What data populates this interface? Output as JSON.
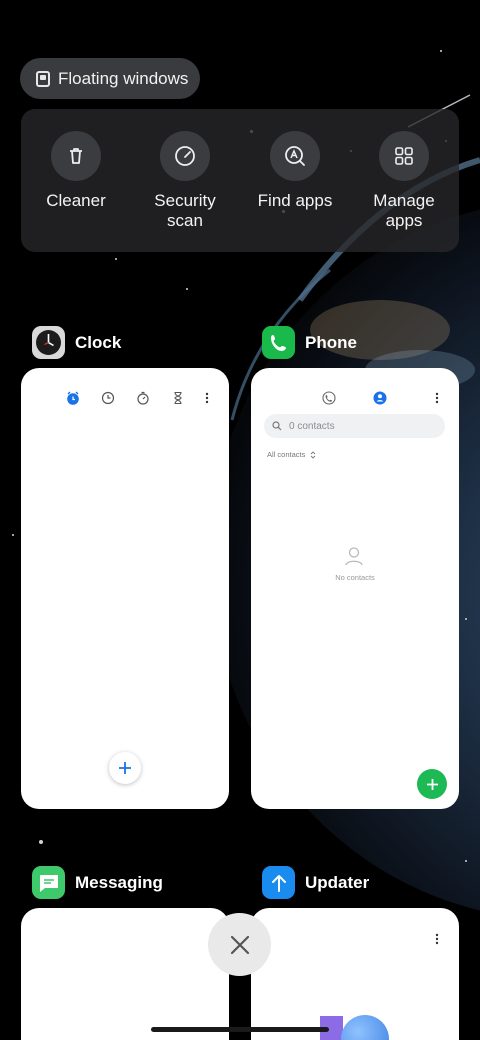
{
  "floating_windows": {
    "label": "Floating windows"
  },
  "quick_actions": [
    {
      "label": "Cleaner",
      "icon": "trash-icon"
    },
    {
      "label": "Security\nscan",
      "label_line1": "Security",
      "label_line2": "scan",
      "icon": "security-scan-icon"
    },
    {
      "label": "Find apps",
      "icon": "find-apps-icon"
    },
    {
      "label_line1": "Manage",
      "label_line2": "apps",
      "icon": "manage-apps-icon"
    }
  ],
  "apps": {
    "clock": {
      "name": "Clock"
    },
    "phone": {
      "name": "Phone",
      "search_placeholder": "0 contacts",
      "filter_label": "All contacts",
      "empty_label": "No contacts"
    },
    "messaging": {
      "name": "Messaging"
    },
    "updater": {
      "name": "Updater"
    }
  },
  "colors": {
    "accent_blue": "#1a73e8",
    "phone_green": "#19b94b",
    "fab_green": "#1db954"
  }
}
